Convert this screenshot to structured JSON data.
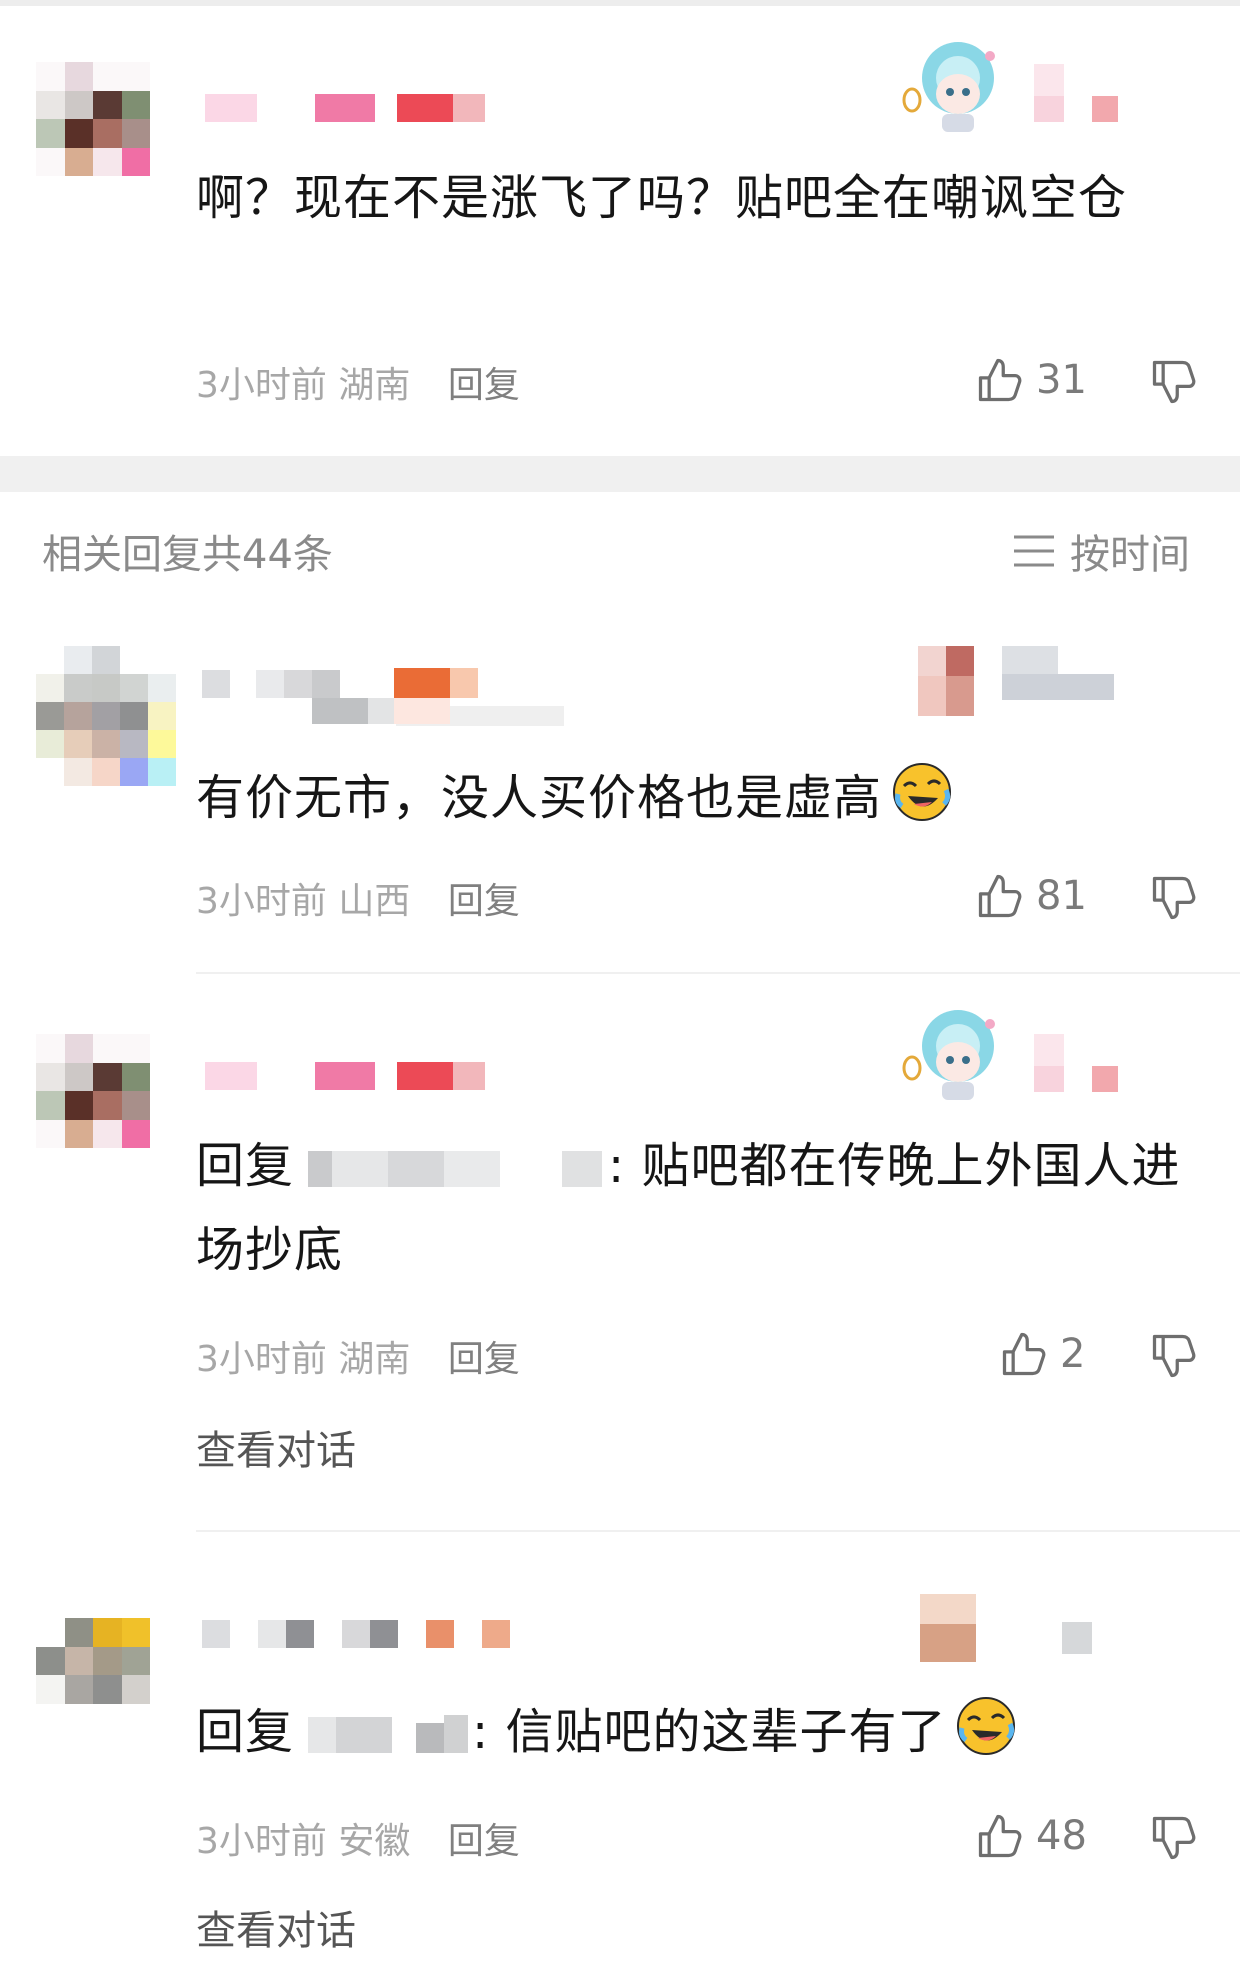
{
  "comment_main": {
    "content": "啊？现在不是涨飞了吗？贴吧全在嘲讽空仓",
    "time": "3小时前",
    "location": "湖南",
    "reply_label": "回复",
    "like_count": "31"
  },
  "replies_header": {
    "title": "相关回复共44条",
    "sort_label": "按时间"
  },
  "replies": [
    {
      "content": "有价无市，没人买价格也是虚高",
      "time": "3小时前",
      "location": "山西",
      "reply_label": "回复",
      "like_count": "81"
    },
    {
      "reply_prefix": "回复",
      "content": ": 贴吧都在传晚上外国人进场抄底",
      "time": "3小时前",
      "location": "湖南",
      "reply_label": "回复",
      "like_count": "2",
      "view_conversation": "查看对话"
    },
    {
      "reply_prefix": "回复",
      "content": ": 信贴吧的这辈子有了",
      "time": "3小时前",
      "location": "安徽",
      "reply_label": "回复",
      "like_count": "48",
      "view_conversation": "查看对话"
    }
  ],
  "icons": {
    "like": "thumbs-up-icon",
    "dislike": "thumbs-down-icon",
    "sort": "menu-lines-icon",
    "emoji": "laughing-crying-emoji-icon"
  },
  "colors": {
    "text": "#161616",
    "meta": "#a7a7a7",
    "divider": "#f0f0f0",
    "emoji_yellow": "#f8c22c"
  }
}
